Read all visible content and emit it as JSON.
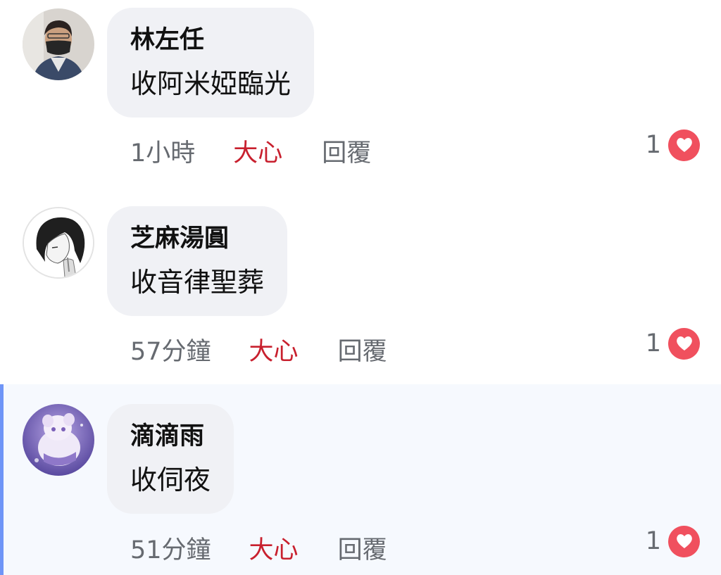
{
  "comments": [
    {
      "author": "林左任",
      "text": "收阿米婭臨光",
      "time": "1小時",
      "react_label": "大心",
      "reply_label": "回覆",
      "like_count": "1",
      "reaction_icon": "heart-icon",
      "avatar": "avatar-masked-person"
    },
    {
      "author": "芝麻湯圓",
      "text": "收音律聖葬",
      "time": "57分鐘",
      "react_label": "大心",
      "reply_label": "回覆",
      "like_count": "1",
      "reaction_icon": "heart-icon",
      "avatar": "avatar-sketch-character"
    },
    {
      "author": "滴滴雨",
      "text": "收伺夜",
      "time": "51分鐘",
      "react_label": "大心",
      "reply_label": "回覆",
      "like_count": "1",
      "reaction_icon": "heart-icon",
      "avatar": "avatar-anime-character"
    }
  ],
  "colors": {
    "react_accent": "#c8202e",
    "heart_badge": "#f0505e",
    "highlight_bar": "#6f95f7",
    "highlight_bg": "#f6f9fe",
    "bubble_bg": "#f0f1f5"
  }
}
